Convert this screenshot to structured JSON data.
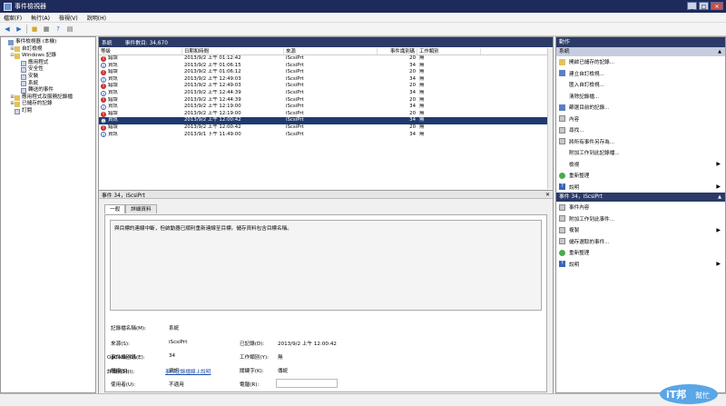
{
  "window": {
    "title": "事件檢視器"
  },
  "menu": [
    "檔案(F)",
    "執行(A)",
    "檢視(V)",
    "說明(H)"
  ],
  "tree": {
    "items": [
      {
        "label": "事件檢視器 (本機)",
        "indent": 0,
        "exp": "",
        "icon": "book"
      },
      {
        "label": "自訂檢視",
        "indent": 1,
        "exp": "+",
        "icon": "folder"
      },
      {
        "label": "Windows 記錄",
        "indent": 1,
        "exp": "−",
        "icon": "folder"
      },
      {
        "label": "應用程式",
        "indent": 2,
        "exp": "",
        "icon": "log"
      },
      {
        "label": "安全性",
        "indent": 2,
        "exp": "",
        "icon": "log"
      },
      {
        "label": "安裝",
        "indent": 2,
        "exp": "",
        "icon": "log"
      },
      {
        "label": "系統",
        "indent": 2,
        "exp": "",
        "icon": "log"
      },
      {
        "label": "轉送的事件",
        "indent": 2,
        "exp": "",
        "icon": "log"
      },
      {
        "label": "應用程式及服務記錄檔",
        "indent": 1,
        "exp": "+",
        "icon": "folder"
      },
      {
        "label": "已儲存的記錄",
        "indent": 1,
        "exp": "+",
        "icon": "folder"
      },
      {
        "label": "訂閱",
        "indent": 1,
        "exp": "",
        "icon": "log"
      }
    ]
  },
  "center": {
    "pane_title": "系統",
    "event_count": "事件數目: 34,670",
    "columns": [
      "等級",
      "日期和時間",
      "來源",
      "事件識別碼",
      "工作類別"
    ],
    "rows": [
      {
        "level": "錯誤",
        "type": "err",
        "date": "2013/9/2 上午 01:12:42",
        "source": "iScsiPrt",
        "id": "20",
        "task": "無"
      },
      {
        "level": "資訊",
        "type": "info",
        "date": "2013/9/2 上午 01:06:15",
        "source": "iScsiPrt",
        "id": "34",
        "task": "無"
      },
      {
        "level": "錯誤",
        "type": "err",
        "date": "2013/9/2 上午 01:06:12",
        "source": "iScsiPrt",
        "id": "20",
        "task": "無"
      },
      {
        "level": "資訊",
        "type": "info",
        "date": "2013/9/2 上午 12:49:03",
        "source": "iScsiPrt",
        "id": "34",
        "task": "無"
      },
      {
        "level": "錯誤",
        "type": "err",
        "date": "2013/9/2 上午 12:49:03",
        "source": "iScsiPrt",
        "id": "20",
        "task": "無"
      },
      {
        "level": "資訊",
        "type": "info",
        "date": "2013/9/2 上午 12:44:39",
        "source": "iScsiPrt",
        "id": "34",
        "task": "無"
      },
      {
        "level": "錯誤",
        "type": "err",
        "date": "2013/9/2 上午 12:44:39",
        "source": "iScsiPrt",
        "id": "20",
        "task": "無"
      },
      {
        "level": "資訊",
        "type": "info",
        "date": "2013/9/2 上午 12:19:00",
        "source": "iScsiPrt",
        "id": "34",
        "task": "無"
      },
      {
        "level": "錯誤",
        "type": "err",
        "date": "2013/9/2 上午 12:19:00",
        "source": "iScsiPrt",
        "id": "20",
        "task": "無"
      },
      {
        "level": "資訊",
        "type": "info",
        "date": "2013/9/2 上午 12:00:42",
        "source": "iScsiPrt",
        "id": "34",
        "task": "無",
        "selected": true
      },
      {
        "level": "錯誤",
        "type": "err",
        "date": "2013/9/2 上午 12:00:42",
        "source": "iScsiPrt",
        "id": "20",
        "task": "無"
      },
      {
        "level": "資訊",
        "type": "info",
        "date": "2013/9/1 下午 11:49:00",
        "source": "iScsiPrt",
        "id": "34",
        "task": "無"
      }
    ]
  },
  "detail": {
    "title": "事件 34，iScsiPrt",
    "tabs": [
      "一般",
      "詳細資料"
    ],
    "message": "與目標的連線中斷，但啟動器已順利重新連線至目標。儲存資料包含目標名稱。",
    "fields": {
      "log_name_label": "記錄檔名稱(M):",
      "log_name": "系統",
      "source_label": "來源(S):",
      "source": "iScsiPrt",
      "logged_label": "已記錄(D):",
      "logged": "2013/9/2 上午 12:00:42",
      "event_id_label": "事件識別碼(E):",
      "event_id": "34",
      "task_label": "工作類別(Y):",
      "task": "無",
      "level_label": "層級(L):",
      "level": "資訊",
      "keywords_label": "關鍵字(K):",
      "keywords": "傳統",
      "user_label": "使用者(U):",
      "user": "不適用",
      "computer_label": "電腦(R):",
      "opcode_label": "OpCode(O):",
      "more_info_label": "詳細資訊(I):",
      "more_info_link": "事件記錄檔線上說明"
    }
  },
  "actions": {
    "header": "動作",
    "section1": "系統",
    "items1": [
      {
        "label": "開啟已儲存的記錄...",
        "icon": "yellow"
      },
      {
        "label": "建立自訂檢視...",
        "icon": "blue"
      },
      {
        "label": "匯入自訂檢視...",
        "icon": "none"
      },
      {
        "label": "清除記錄檔...",
        "icon": "none"
      },
      {
        "label": "篩選目前的記錄...",
        "icon": "blue"
      },
      {
        "label": "內容",
        "icon": "gray"
      },
      {
        "label": "尋找...",
        "icon": "gray"
      },
      {
        "label": "將所有事件另存為...",
        "icon": "gray"
      },
      {
        "label": "附加工作到此記錄檔...",
        "icon": "none"
      },
      {
        "label": "檢視",
        "icon": "none",
        "sub": true
      },
      {
        "label": "重新整理",
        "icon": "green"
      },
      {
        "label": "說明",
        "icon": "help",
        "sub": true
      }
    ],
    "section2": "事件 34，iScsiPrt",
    "items2": [
      {
        "label": "事件內容",
        "icon": "gray"
      },
      {
        "label": "附加工作到此事件...",
        "icon": "gray"
      },
      {
        "label": "複製",
        "icon": "gray",
        "sub": true
      },
      {
        "label": "儲存選取的事件...",
        "icon": "gray"
      },
      {
        "label": "重新整理",
        "icon": "green"
      },
      {
        "label": "說明",
        "icon": "help",
        "sub": true
      }
    ]
  },
  "colors": {
    "header_bg": "#2b3a67",
    "selection": "#1f3a6e",
    "error": "#c9302c",
    "link": "#1b4fa8"
  }
}
